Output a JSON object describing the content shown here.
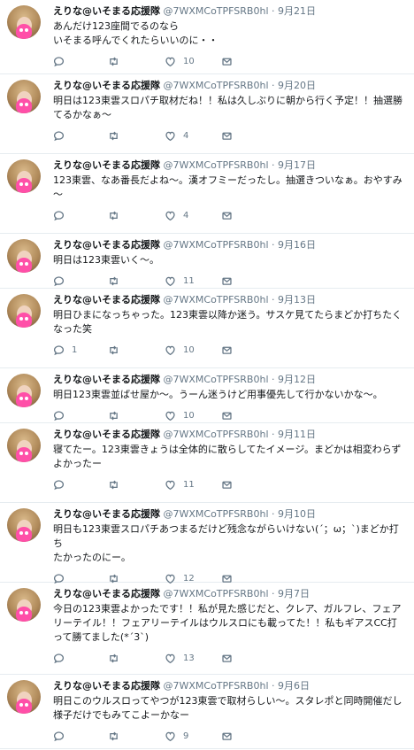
{
  "timeline": {
    "tweets": [
      {
        "name": "えりな@いそまる応援隊",
        "handle": "@7WXMCoTPFSRB0hl",
        "sep": "·",
        "date": "9月21日",
        "lines": [
          "あんだけ123座間でるのなら",
          "いそまる呼んでくれたらいいのに・・"
        ],
        "reply_count": "",
        "retweet_count": "",
        "like_count": "10"
      },
      {
        "name": "えりな@いそまる応援隊",
        "handle": "@7WXMCoTPFSRB0hl",
        "sep": "·",
        "date": "9月20日",
        "lines": [
          "明日は123東雲スロパチ取材だね！！私は久しぶりに朝から行く予定！！抽選勝",
          "てるかなぁ～"
        ],
        "reply_count": "",
        "retweet_count": "",
        "like_count": "4"
      },
      {
        "name": "えりな@いそまる応援隊",
        "handle": "@7WXMCoTPFSRB0hl",
        "sep": "·",
        "date": "9月17日",
        "lines": [
          "123東雲、なあ番長だよね～。漢オフミーだったし。抽選きついなぁ。おやすみ",
          "～"
        ],
        "reply_count": "",
        "retweet_count": "",
        "like_count": "4"
      },
      {
        "name": "えりな@いそまる応援隊",
        "handle": "@7WXMCoTPFSRB0hl",
        "sep": "·",
        "date": "9月16日",
        "lines": [
          "明日は123東雲いく～。"
        ],
        "reply_count": "",
        "retweet_count": "",
        "like_count": "11"
      },
      {
        "name": "えりな@いそまる応援隊",
        "handle": "@7WXMCoTPFSRB0hl",
        "sep": "·",
        "date": "9月13日",
        "lines": [
          "明日ひまになっちゃった。123東雲以降か迷う。サスケ見てたらまどか打ちたく",
          "なった笑"
        ],
        "reply_count": "1",
        "retweet_count": "",
        "like_count": "10"
      },
      {
        "name": "えりな@いそまる応援隊",
        "handle": "@7WXMCoTPFSRB0hl",
        "sep": "·",
        "date": "9月12日",
        "lines": [
          "明日123東雲並ばせ屋か～。うーん迷うけど用事優先して行かないかな～。"
        ],
        "reply_count": "",
        "retweet_count": "",
        "like_count": "10"
      },
      {
        "name": "えりな@いそまる応援隊",
        "handle": "@7WXMCoTPFSRB0hl",
        "sep": "·",
        "date": "9月11日",
        "lines": [
          "寝てたー。123東雲きょうは全体的に散らしてたイメージ。まどかは相変わらず",
          "よかったー"
        ],
        "reply_count": "",
        "retweet_count": "",
        "like_count": "11"
      },
      {
        "name": "えりな@いそまる応援隊",
        "handle": "@7WXMCoTPFSRB0hl",
        "sep": "·",
        "date": "9月10日",
        "lines": [
          "明日も123東雲スロパチあつまるだけど残念ながらいけない(´；ω；`)まどか打ち",
          "たかったのにー。"
        ],
        "reply_count": "",
        "retweet_count": "",
        "like_count": "12"
      },
      {
        "name": "えりな@いそまる応援隊",
        "handle": "@7WXMCoTPFSRB0hl",
        "sep": "·",
        "date": "9月7日",
        "lines": [
          "今日の123東雲よかったです！！私が見た感じだと、クレア、ガルフレ、フェア",
          "リーテイル！！フェアリーテイルはウルスロにも載ってた！！私もギアスCC打",
          "って勝てました(*ˊ3ˋ)"
        ],
        "reply_count": "",
        "retweet_count": "",
        "like_count": "13"
      },
      {
        "name": "えりな@いそまる応援隊",
        "handle": "@7WXMCoTPFSRB0hl",
        "sep": "·",
        "date": "9月6日",
        "lines": [
          "明日このウルスロってやつが123東雲で取材らしい～。スタレポと同時開催だし",
          "様子だけでもみてこよーかなー"
        ],
        "reply_count": "",
        "retweet_count": "",
        "like_count": "9"
      }
    ]
  }
}
